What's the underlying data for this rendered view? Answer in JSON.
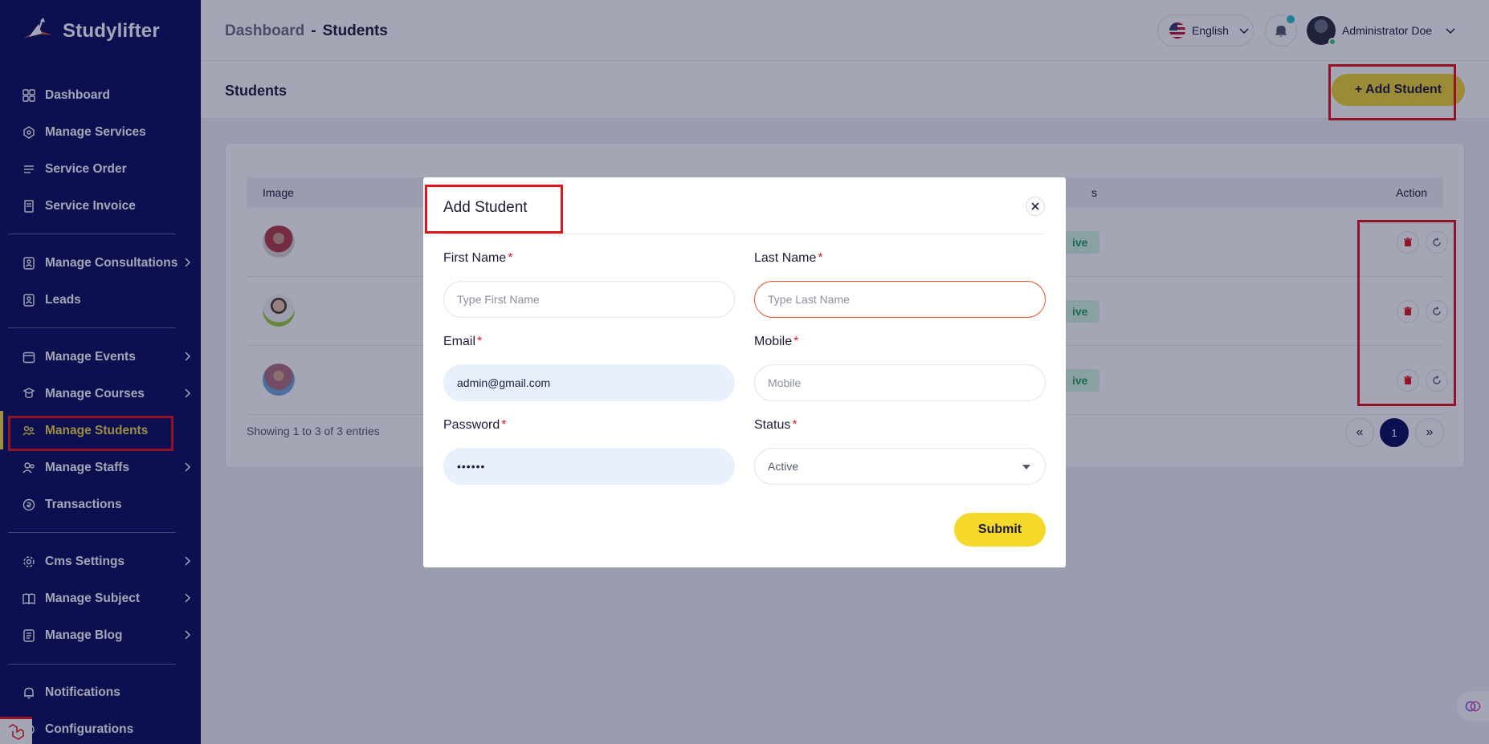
{
  "brand": {
    "name": "Studylifter"
  },
  "sidebar": {
    "items": [
      {
        "label": "Dashboard",
        "icon": "dashboard-icon"
      },
      {
        "label": "Manage Services",
        "icon": "services-icon"
      },
      {
        "label": "Service Order",
        "icon": "order-icon"
      },
      {
        "label": "Service Invoice",
        "icon": "invoice-icon"
      },
      {
        "label": "Manage Consultations",
        "icon": "consultation-icon"
      },
      {
        "label": "Leads",
        "icon": "leads-icon"
      },
      {
        "label": "Manage Events",
        "icon": "calendar-icon"
      },
      {
        "label": "Manage Courses",
        "icon": "courses-icon"
      },
      {
        "label": "Manage Students",
        "icon": "students-icon"
      },
      {
        "label": "Manage Staffs",
        "icon": "staffs-icon"
      },
      {
        "label": "Transactions",
        "icon": "transactions-icon"
      },
      {
        "label": "Cms Settings",
        "icon": "cms-gear-icon"
      },
      {
        "label": "Manage Subject",
        "icon": "book-icon"
      },
      {
        "label": "Manage Blog",
        "icon": "blog-icon"
      },
      {
        "label": "Notifications",
        "icon": "bell-icon"
      },
      {
        "label": "Configurations",
        "icon": "configuration-icon"
      }
    ],
    "active": "Manage Students"
  },
  "header": {
    "breadcrumb_parent": "Dashboard",
    "breadcrumb_sep": "-",
    "breadcrumb_current": "Students",
    "language": "English",
    "user_name": "Administrator Doe"
  },
  "page": {
    "title": "Students",
    "add_button": "+ Add Student"
  },
  "table": {
    "columns": {
      "image": "Image",
      "status": "s",
      "action": "Action"
    },
    "rows": [
      {
        "status": "ive"
      },
      {
        "status": "ive"
      },
      {
        "status": "ive"
      }
    ],
    "entries_text": "Showing 1 to 3 of 3 entries",
    "pagination": {
      "prev": "«",
      "current": "1",
      "next": "»"
    }
  },
  "modal": {
    "title": "Add Student",
    "fields": {
      "first_name": {
        "label": "First Name",
        "placeholder": "Type First Name",
        "value": ""
      },
      "last_name": {
        "label": "Last Name",
        "placeholder": "Type Last Name",
        "value": ""
      },
      "email": {
        "label": "Email",
        "placeholder": "",
        "value": "admin@gmail.com"
      },
      "mobile": {
        "label": "Mobile",
        "placeholder": "Mobile",
        "value": ""
      },
      "password": {
        "label": "Password",
        "value": "••••••"
      },
      "status": {
        "label": "Status",
        "value": "Active"
      }
    },
    "required_mark": "*",
    "submit": "Submit"
  },
  "colors": {
    "sidebar_bg": "#0b0e5e",
    "accent_yellow": "#f3d332",
    "highlight_red": "#e4131b",
    "active_badge_bg": "#d7f5e2",
    "active_badge_text": "#21a05a"
  }
}
